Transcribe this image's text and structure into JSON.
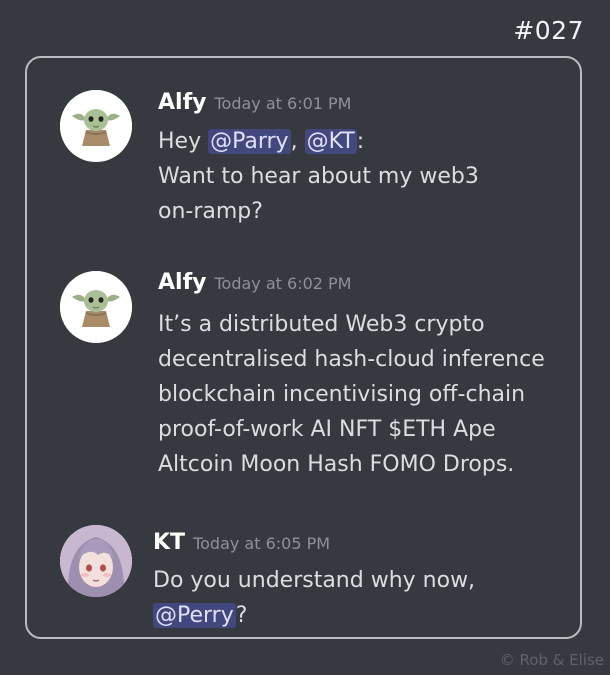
{
  "comic_number": "#027",
  "credit": "© Rob & Elise",
  "messages": [
    {
      "username": "Alfy",
      "timestamp": "Today at 6:01 PM",
      "lines": [
        [
          "Hey ",
          {
            "mention": "@Parry"
          },
          ", ",
          {
            "mention": "@KT"
          },
          ":"
        ],
        [
          "Want to hear about my web3"
        ],
        [
          "on-ramp?"
        ]
      ]
    },
    {
      "username": "Alfy",
      "timestamp": "Today at 6:02 PM",
      "lines": [
        [
          "It’s a distributed Web3 crypto"
        ],
        [
          "decentralised hash-cloud inference"
        ],
        [
          "blockchain incentivising off-chain"
        ],
        [
          "proof-of-work AI NFT $ETH Ape"
        ],
        [
          "Altcoin Moon Hash FOMO Drops."
        ]
      ]
    },
    {
      "username": "KT",
      "timestamp": "Today at 6:05 PM",
      "lines": [
        [
          "Do you understand why now,"
        ],
        [
          {
            "mention": "@Perry"
          },
          "?"
        ]
      ]
    }
  ]
}
